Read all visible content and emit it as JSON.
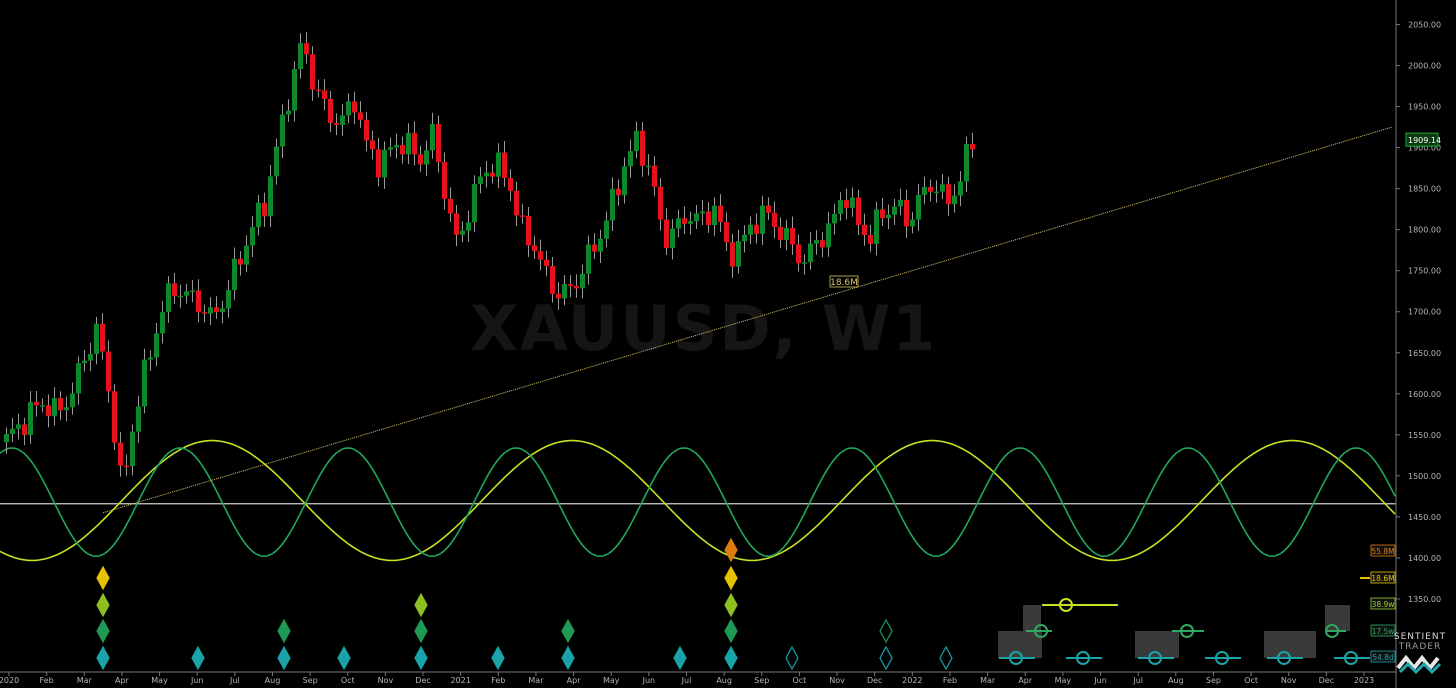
{
  "chart_data": {
    "type": "candlestick",
    "symbol_watermark": "XAUUSD, W1",
    "last_price": "1909.14",
    "colors": {
      "up": "#0a8a2a",
      "down": "#e8101a",
      "wick": "#9a9a9a",
      "background": "#000000",
      "trendline": "#d9c86a",
      "cycle_light": "#c8e020",
      "cycle_green": "#1fa85a",
      "baseline": "#cfcfcf"
    },
    "yaxis": {
      "min": 1300,
      "max": 2075,
      "ticks": [
        "2050.00",
        "2000.00",
        "1950.00",
        "1900.00",
        "1850.00",
        "1800.00",
        "1750.00",
        "1700.00",
        "1650.00",
        "1600.00",
        "1550.00",
        "1500.00",
        "1450.00",
        "1400.00",
        "1350.00"
      ]
    },
    "xaxis": {
      "labels": [
        "2020",
        "Feb",
        "Mar",
        "Apr",
        "May",
        "Jun",
        "Jul",
        "Aug",
        "Sep",
        "Oct",
        "Nov",
        "Dec",
        "2021",
        "Feb",
        "Mar",
        "Apr",
        "May",
        "Jun",
        "Jul",
        "Aug",
        "Sep",
        "Oct",
        "Nov",
        "Dec",
        "2022",
        "Feb",
        "Mar",
        "Apr",
        "May",
        "Jun",
        "Jul",
        "Aug",
        "Sep",
        "Oct",
        "Nov",
        "Dec",
        "2023"
      ]
    },
    "waypoints": [
      1545,
      1560,
      1580,
      1590,
      1575,
      1600,
      1640,
      1680,
      1600,
      1480,
      1580,
      1640,
      1700,
      1730,
      1720,
      1710,
      1690,
      1720,
      1760,
      1800,
      1830,
      1900,
      1970,
      2030,
      1970,
      1940,
      1930,
      1960,
      1900,
      1880,
      1900,
      1910,
      1880,
      1920,
      1850,
      1780,
      1830,
      1870,
      1880,
      1860,
      1800,
      1780,
      1740,
      1720,
      1730,
      1760,
      1790,
      1830,
      1880,
      1910,
      1870,
      1790,
      1800,
      1820,
      1810,
      1830,
      1770,
      1780,
      1810,
      1820,
      1800,
      1780,
      1760,
      1790,
      1800,
      1850,
      1810,
      1790,
      1820,
      1830,
      1810,
      1840,
      1860,
      1830,
      1860,
      1909
    ],
    "trendline": {
      "start_price": 1455,
      "end_price": 1925
    },
    "trendline_label": "18.6M",
    "baseline_level": 1466,
    "cycle_labels": [
      "55.8M",
      "18.6M",
      "38.9w",
      "17.5w",
      "54.8d"
    ],
    "cycle_label_colors": [
      "#e07b10",
      "#e6c200",
      "#9acd32",
      "#2fa860",
      "#1aa3a8"
    ],
    "brand": [
      "SENTIENT",
      "TRADER"
    ]
  }
}
